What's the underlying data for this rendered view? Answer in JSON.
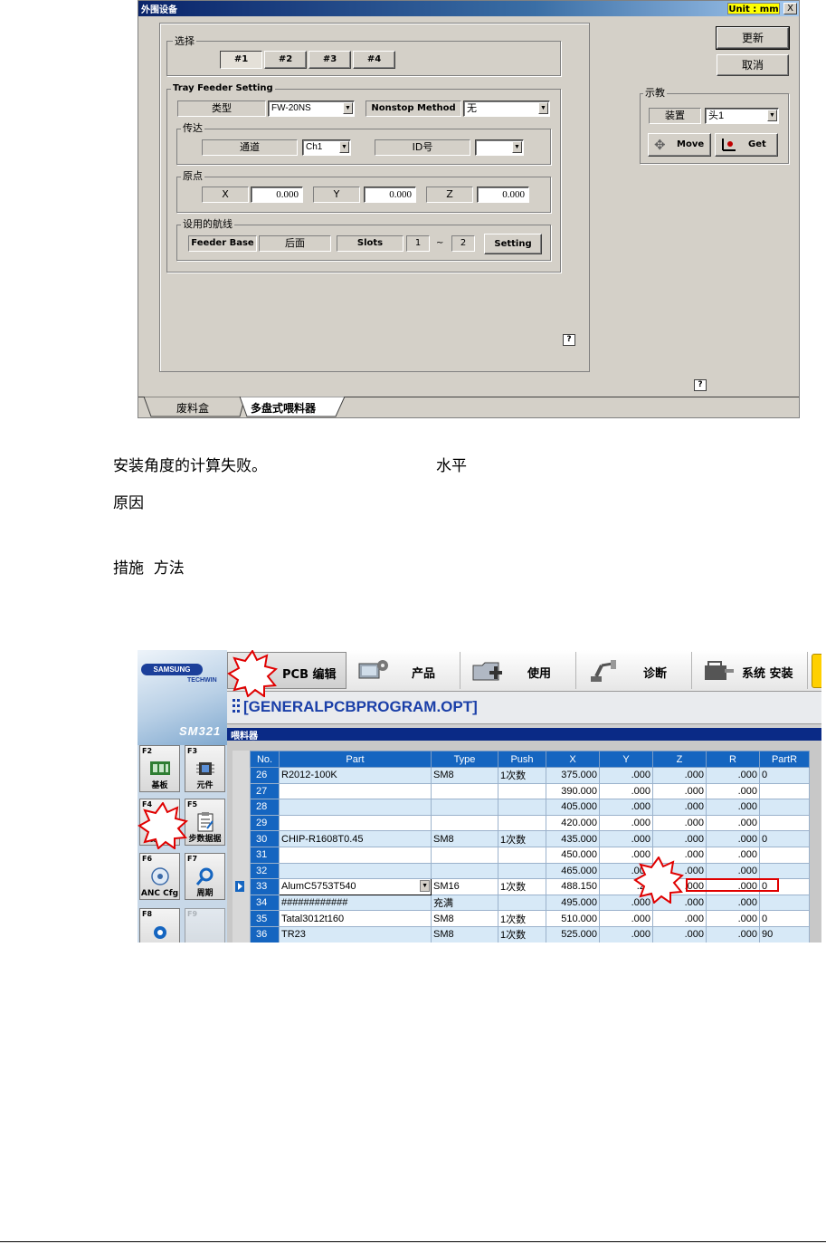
{
  "dialog": {
    "title": "外围设备",
    "unit": "Unit : mm",
    "close": "X",
    "select_group": {
      "label": "选择",
      "buttons": [
        "#1",
        "#2",
        "#3",
        "#4"
      ],
      "selected": "#1"
    },
    "update_button": "更新",
    "cancel_button": "取消",
    "tray_feeder": {
      "label": "Tray Feeder Setting",
      "type_label": "类型",
      "type_value": "FW-20NS",
      "nonstop_label": "Nonstop Method",
      "nonstop_value": "无",
      "transfer": {
        "label": "传达",
        "channel_label": "通道",
        "channel_value": "Ch1",
        "id_label": "ID号",
        "id_value": ""
      },
      "origin": {
        "label": "原点",
        "x_label": "X",
        "x_value": "0.000",
        "y_label": "Y",
        "y_value": "0.000",
        "z_label": "Z",
        "z_value": "0.000"
      },
      "lane": {
        "label": "设用的航线",
        "feeder_base_label": "Feeder Base",
        "feeder_base_value": "后面",
        "slots_label": "Slots",
        "slot_from": "1",
        "slot_sep": "~",
        "slot_to": "2",
        "setting_button": "Setting"
      }
    },
    "teach": {
      "label": "示教",
      "device_label": "装置",
      "device_value": "头1",
      "move_button": "Move",
      "get_button": "Get"
    },
    "help": "?",
    "tabs": [
      "废料盒",
      "多盘式喂料器"
    ],
    "active_tab": "多盘式喂料器"
  },
  "text": {
    "line1a": "安装角度的计算失败。",
    "line1b": "水平",
    "line2": "原因",
    "line3": "措施  方法"
  },
  "app": {
    "logo": "SAMSUNG",
    "logo_sub": "TECHWIN",
    "model": "SM321",
    "toolbar": [
      "PCB 编辑",
      "产品",
      "使用",
      "诊断",
      "系统 安装"
    ],
    "path": "[GENERALPCBPROGRAM.OPT]",
    "section": "喂料器",
    "fkeys": [
      {
        "key": "F2",
        "label": "基板"
      },
      {
        "key": "F3",
        "label": "元件"
      },
      {
        "key": "F4",
        "label": "喂料器"
      },
      {
        "key": "F5",
        "label": "步数据据"
      },
      {
        "key": "F6",
        "label": "ANC Cfg"
      },
      {
        "key": "F7",
        "label": "周期"
      },
      {
        "key": "F8",
        "label": ""
      },
      {
        "key": "F9",
        "label": ""
      }
    ],
    "grid": {
      "columns": [
        "No.",
        "Part",
        "Type",
        "Push",
        "X",
        "Y",
        "Z",
        "R",
        "PartR"
      ],
      "rows": [
        [
          "26",
          "R2012-100K",
          "SM8",
          "1次数",
          "375.000",
          ".000",
          ".000",
          ".000",
          "0"
        ],
        [
          "27",
          "",
          "",
          "",
          "390.000",
          ".000",
          ".000",
          ".000",
          ""
        ],
        [
          "28",
          "",
          "",
          "",
          "405.000",
          ".000",
          ".000",
          ".000",
          ""
        ],
        [
          "29",
          "",
          "",
          "",
          "420.000",
          ".000",
          ".000",
          ".000",
          ""
        ],
        [
          "30",
          "CHIP-R1608T0.45",
          "SM8",
          "1次数",
          "435.000",
          ".000",
          ".000",
          ".000",
          "0"
        ],
        [
          "31",
          "",
          "",
          "",
          "450.000",
          ".000",
          ".000",
          ".000",
          ""
        ],
        [
          "32",
          "",
          "",
          "",
          "465.000",
          ".000",
          ".000",
          ".000",
          ""
        ],
        [
          "33",
          "AlumC5753T540",
          "SM16",
          "1次数",
          "488.150",
          ".25",
          ".000",
          ".000",
          "0"
        ],
        [
          "34",
          "############",
          "充满",
          "",
          "495.000",
          ".000",
          ".000",
          ".000",
          ""
        ],
        [
          "35",
          "Tatal3012t160",
          "SM8",
          "1次数",
          "510.000",
          ".000",
          ".000",
          ".000",
          "0"
        ],
        [
          "36",
          "TR23",
          "SM8",
          "1次数",
          "525.000",
          ".000",
          ".000",
          ".000",
          "90"
        ]
      ]
    }
  }
}
